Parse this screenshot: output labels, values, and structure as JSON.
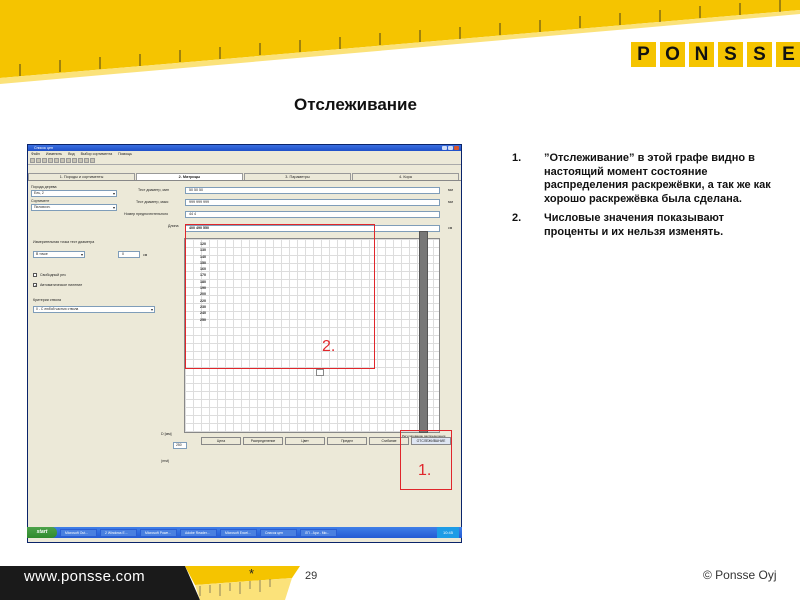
{
  "logo_letters": [
    "P",
    "O",
    "N",
    "S",
    "S",
    "E"
  ],
  "title": "Отслеживание",
  "notes": [
    {
      "num": "1.",
      "text": "”Отслеживание” в этой графе видно в настоящий момент состояние распределения раскрежёвки, а так же как хорошо раскрежёвка была сделана."
    },
    {
      "num": "2.",
      "text": "Числовые значения показывают проценты и их нельзя изменять."
    }
  ],
  "screenshot": {
    "window_title": "Список цен",
    "menu": [
      "Файл",
      "Изменить",
      "Вид",
      "Выбор сортимента",
      "Помощь"
    ],
    "tabs": [
      {
        "label": "1. Породы и сортименты",
        "active": false
      },
      {
        "label": "2. Матрицы",
        "active": true
      },
      {
        "label": "3. Параметры",
        "active": false
      },
      {
        "label": "4. Кора",
        "active": false
      }
    ],
    "left": {
      "species_label": "Порода дерева",
      "species_value": "Ель, 2",
      "sortiment_label": "Сортимент",
      "sortiment_value": "Пиловочн.",
      "measure_label": "Измерительная точка тест диаметра",
      "measure_value": "В точке",
      "measure_num": "0",
      "measure_unit": "см",
      "free_len": "Свободный рез",
      "auto_len": "Автоматическое пиление",
      "criteria_label": "Критерии ствола",
      "criteria_value": "0 - С любой частью ствола"
    },
    "main": {
      "test_min_label": "Тест диаметр, мин",
      "test_min_value": "50  50  50",
      "test_max_label": "Тест диаметр, макс",
      "test_max_value": "999  999  999",
      "prior_label": "Номер предпочтительного",
      "prior_value": "44      4",
      "len_label": "Длина",
      "len_value": "400  490  550",
      "unit_mm": "мм",
      "unit_sm": "см",
      "row_values": [
        "120",
        "130",
        "140",
        "150",
        "160",
        "170",
        "180",
        "190",
        "200",
        "220",
        "230",
        "240",
        "250"
      ],
      "diam_label": "D [мм]",
      "diam_value": "250",
      "msn": "(mst)",
      "bottom": [
        {
          "label": "Цена",
          "blue": false
        },
        {
          "label": "Распределение",
          "blue": false
        },
        {
          "label": "Цвет",
          "blue": false
        },
        {
          "label": "Предел",
          "blue": false
        },
        {
          "label": "Сгибание",
          "blue": false
        },
        {
          "label": "ОТСЛЕЖИВАНИЕ",
          "blue": true
        }
      ],
      "tracking_caption": "Регулирование распределения"
    },
    "taskbar": {
      "start": "start",
      "items": [
        "Microsoft Out...",
        "2 Windows E...",
        "Microsoft Powe...",
        "Adobe Reader...",
        "Microsoft Excel...",
        "Список цен",
        "ЛП - Ари - Ми..."
      ],
      "tray": "10:45"
    }
  },
  "callouts": [
    "2.",
    "1."
  ],
  "footer": {
    "url": "www.ponsse.com",
    "asterisk": "*",
    "page": "29",
    "copyright": "© Ponsse Oyj"
  },
  "colors": {
    "brand_yellow": "#f5c400",
    "callout_red": "#e0262b",
    "xp_blue": "#245bd3"
  }
}
